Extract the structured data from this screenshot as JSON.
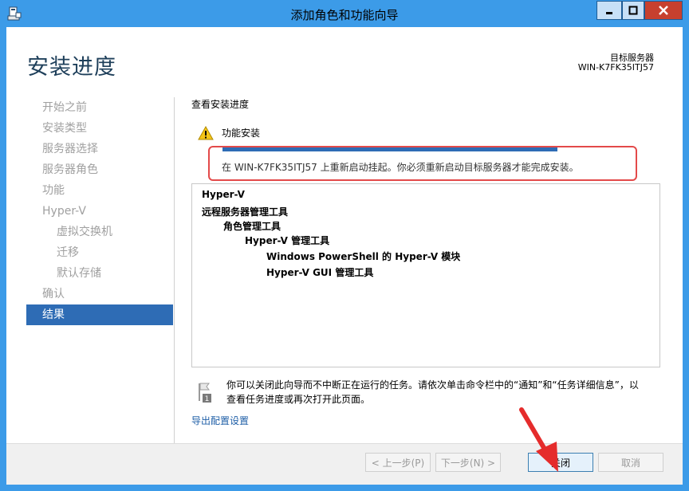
{
  "window": {
    "title": "添加角色和功能向导",
    "icons": {
      "app": "server-manager-icon",
      "minimize": "minimize-icon",
      "maximize": "maximize-icon",
      "close": "close-icon"
    }
  },
  "header": {
    "page_title": "安装进度",
    "destination_label": "目标服务器",
    "destination_server": "WIN-K7FK35ITJ57"
  },
  "nav": {
    "items": [
      {
        "label": "开始之前"
      },
      {
        "label": "安装类型"
      },
      {
        "label": "服务器选择"
      },
      {
        "label": "服务器角色"
      },
      {
        "label": "功能"
      },
      {
        "label": "Hyper-V"
      },
      {
        "label": "虚拟交换机"
      },
      {
        "label": "迁移"
      },
      {
        "label": "默认存储"
      },
      {
        "label": "确认"
      },
      {
        "label": "结果"
      }
    ],
    "active_index": 10
  },
  "main": {
    "section_label": "查看安装进度",
    "status_title": "功能安装",
    "progress": 1.0,
    "message": "在 WIN-K7FK35ITJ57 上重新启动挂起。你必须重新启动目标服务器才能完成安装。",
    "results": [
      {
        "label": "Hyper-V",
        "level": 0
      },
      {
        "label": "远程服务器管理工具",
        "level": 0
      },
      {
        "label": "角色管理工具",
        "level": 1
      },
      {
        "label": "Hyper-V 管理工具",
        "level": 2
      },
      {
        "label": "Windows PowerShell 的 Hyper-V 模块",
        "level": 3
      },
      {
        "label": "Hyper-V GUI 管理工具",
        "level": 3
      }
    ],
    "note_line1": "你可以关闭此向导而不中断正在运行的任务。请依次单击命令栏中的“通知”和“任务详细信息”，以",
    "note_line2": "查看任务进度或再次打开此页面。",
    "export_link": "导出配置设置"
  },
  "footer": {
    "prev": "< 上一步(P)",
    "next": "下一步(N) >",
    "close": "关闭",
    "cancel": "取消"
  },
  "colors": {
    "titlebar": "#3c9be8",
    "accent": "#2e6cb5",
    "highlight": "#e34a4a",
    "close_button": "#c7402e"
  }
}
